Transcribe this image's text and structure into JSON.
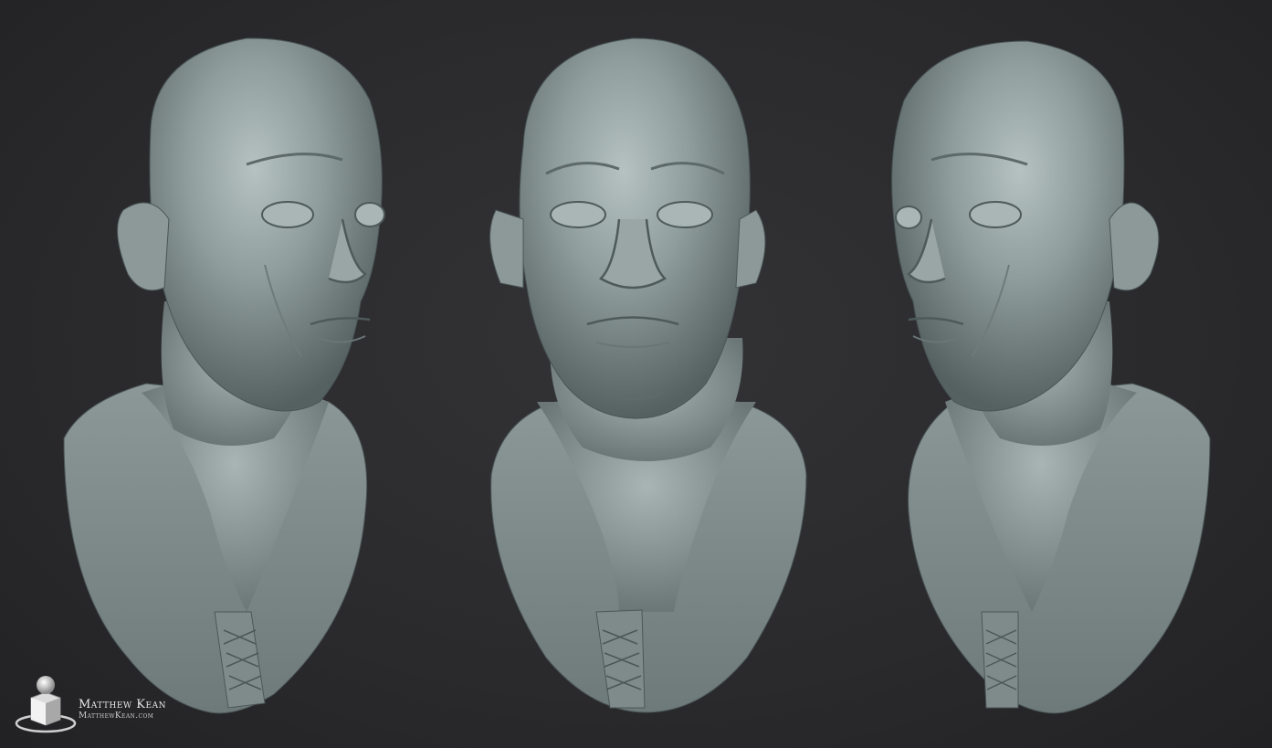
{
  "scene": {
    "background_color": "#2b2b2d",
    "clay_color": "#8f9c9c",
    "views": [
      {
        "name": "three-quarter-left"
      },
      {
        "name": "front"
      },
      {
        "name": "three-quarter-right"
      }
    ]
  },
  "watermark": {
    "name": "Matthew Kean",
    "site": "MatthewKean.com",
    "logo_icon": "sphere-on-cube-logo"
  }
}
